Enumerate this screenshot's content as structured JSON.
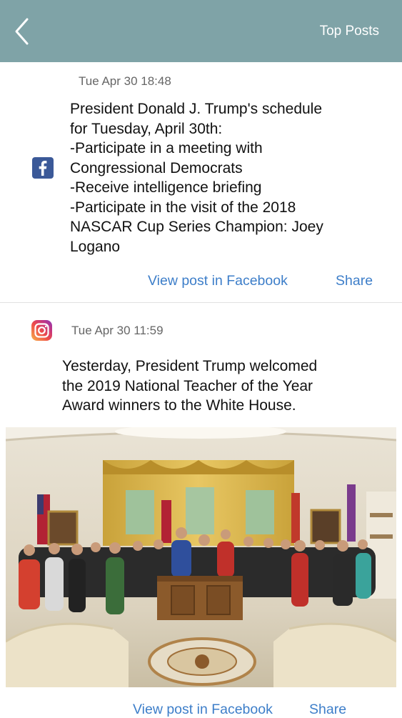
{
  "header": {
    "title": "Top Posts",
    "bar_color": "#7fa3a7"
  },
  "posts": [
    {
      "source": "facebook",
      "source_icon": "facebook-icon",
      "date": "Tue Apr 30 18:48",
      "text": "President Donald J. Trump's schedule\nfor Tuesday, April 30th:\n-Participate in a meeting with\nCongressional Democrats\n-Receive intelligence briefing\n-Participate in the visit of the 2018\nNASCAR Cup Series Champion: Joey\nLogano",
      "view_label": "View post in Facebook",
      "share_label": "Share"
    },
    {
      "source": "instagram",
      "source_icon": "instagram-icon",
      "date": "Tue Apr 30 11:59",
      "text": "Yesterday, President Trump welcomed\nthe 2019 National Teacher of the Year\nAward winners to the White House.",
      "image_description": "Group photo in the Oval Office",
      "view_label": "View post in Facebook",
      "share_label": "Share"
    }
  ],
  "colors": {
    "link": "#3d7ec9",
    "facebook": "#3b5998"
  }
}
